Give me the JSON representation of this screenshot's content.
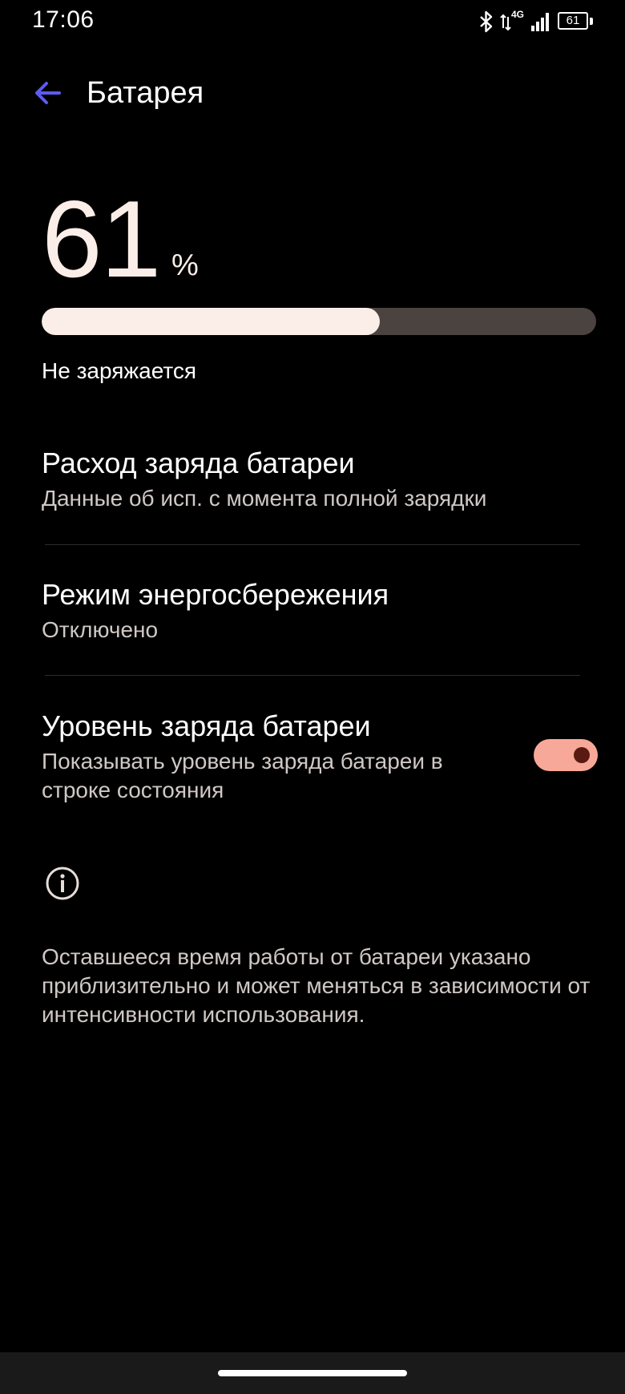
{
  "status_bar": {
    "time": "17:06",
    "network_label": "4G",
    "battery_level": "61",
    "icons": [
      "bluetooth-icon",
      "data-arrows-icon",
      "signal-icon",
      "battery-icon"
    ]
  },
  "header": {
    "title": "Батарея",
    "back_icon": "arrow-left-icon"
  },
  "battery": {
    "percent_value": "61",
    "percent_sign": "%",
    "level_fraction": 0.61,
    "status_text": "Не заряжается"
  },
  "settings": {
    "items": [
      {
        "title": "Расход заряда батареи",
        "subtitle": "Данные об исп. с момента полной зарядки"
      },
      {
        "title": "Режим энергосбережения",
        "subtitle": "Отключено"
      },
      {
        "title": "Уровень заряда батареи",
        "subtitle": "Показывать уровень заряда батареи в строке состояния",
        "toggle_on": true
      }
    ]
  },
  "info": {
    "icon": "info-icon",
    "text": "Оставшееся время работы от батареи указано приблизительно и может меняться в зависимости от интенсивности использования."
  },
  "colors": {
    "background": "#000000",
    "accent_arrow": "#5b5bf0",
    "level_fill": "#fbeee9",
    "level_track": "#4a4340",
    "toggle_track": "#f8a898",
    "toggle_knob": "#5a1a12"
  }
}
